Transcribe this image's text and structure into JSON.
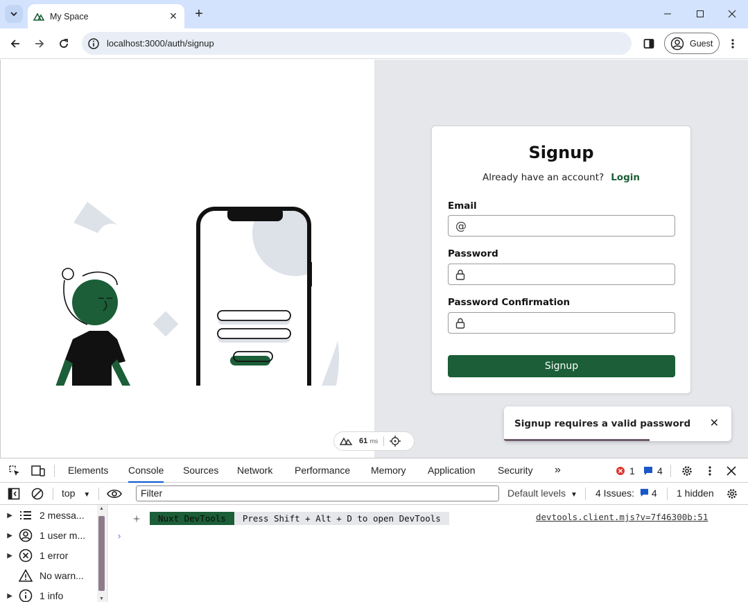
{
  "browser": {
    "tab_title": "My Space",
    "url": "localhost:3000/auth/signup",
    "profile_label": "Guest"
  },
  "signup": {
    "title": "Signup",
    "already_text": "Already have an account?",
    "login_link": "Login",
    "email_label": "Email",
    "password_label": "Password",
    "password_confirm_label": "Password Confirmation",
    "submit_label": "Signup"
  },
  "toast": {
    "message": "Signup requires a valid password",
    "progress": 0.64
  },
  "nuxt_pill": {
    "ms_value": "61",
    "ms_unit": "ms"
  },
  "devtools": {
    "tabs": [
      "Elements",
      "Console",
      "Sources",
      "Network",
      "Performance",
      "Memory",
      "Application",
      "Security"
    ],
    "active_tab": "Console",
    "error_count": "1",
    "message_count": "4",
    "context": "top",
    "filter_placeholder": "Filter",
    "levels": "Default levels",
    "issues_label": "4 Issues:",
    "issues_count": "4",
    "hidden_label": "1 hidden",
    "sidebar": [
      {
        "label": "2 messa...",
        "icon": "list-icon"
      },
      {
        "label": "1 user m...",
        "icon": "user-icon"
      },
      {
        "label": "1 error",
        "icon": "error-icon"
      },
      {
        "label": "No warn...",
        "icon": "warning-icon"
      },
      {
        "label": "1 info",
        "icon": "info-icon"
      }
    ],
    "log": {
      "badge": "Nuxt DevTools",
      "message": "Press Shift + Alt + D to open DevTools",
      "source": "devtools.client.mjs?v=7f46300b:51"
    }
  },
  "colors": {
    "brand_green": "#1b5e37",
    "chrome_blue": "#d3e3fd",
    "right_pane": "#e5e7eb"
  }
}
